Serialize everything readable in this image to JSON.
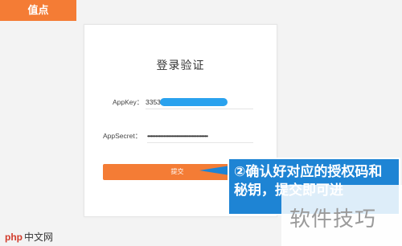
{
  "top_tab": {
    "label": "值点"
  },
  "login": {
    "title": "登录验证",
    "appkey": {
      "label": "AppKey：",
      "value": "3353"
    },
    "appsecret": {
      "label": "AppSecret：",
      "value": "••••••••••••••••••••••••••••••••••••••"
    },
    "submit_label": "提交"
  },
  "callout": {
    "text": "②确认好对应的授权码和秘钥，提交即可进"
  },
  "watermark": {
    "text": "软件技巧"
  },
  "corner_logo": {
    "brand": "php",
    "site": "中文网"
  },
  "colors": {
    "accent": "#f47c35",
    "callout": "#1e84d4",
    "redaction": "#2aa2ee"
  }
}
